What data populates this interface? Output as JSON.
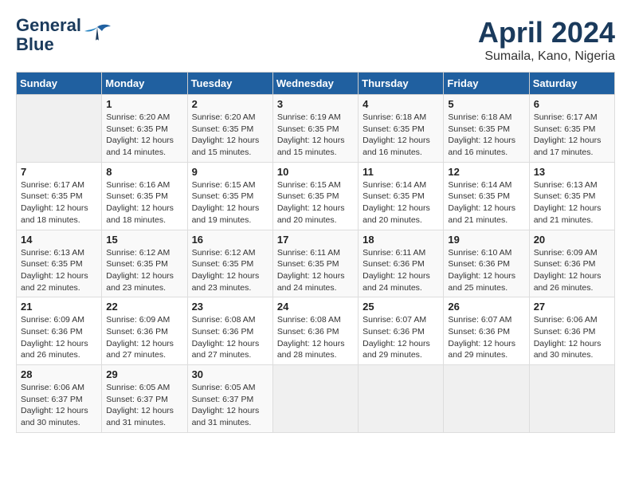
{
  "header": {
    "logo_line1": "General",
    "logo_line2": "Blue",
    "month": "April 2024",
    "location": "Sumaila, Kano, Nigeria"
  },
  "weekdays": [
    "Sunday",
    "Monday",
    "Tuesday",
    "Wednesday",
    "Thursday",
    "Friday",
    "Saturday"
  ],
  "weeks": [
    [
      {
        "day": "",
        "info": ""
      },
      {
        "day": "1",
        "info": "Sunrise: 6:20 AM\nSunset: 6:35 PM\nDaylight: 12 hours\nand 14 minutes."
      },
      {
        "day": "2",
        "info": "Sunrise: 6:20 AM\nSunset: 6:35 PM\nDaylight: 12 hours\nand 15 minutes."
      },
      {
        "day": "3",
        "info": "Sunrise: 6:19 AM\nSunset: 6:35 PM\nDaylight: 12 hours\nand 15 minutes."
      },
      {
        "day": "4",
        "info": "Sunrise: 6:18 AM\nSunset: 6:35 PM\nDaylight: 12 hours\nand 16 minutes."
      },
      {
        "day": "5",
        "info": "Sunrise: 6:18 AM\nSunset: 6:35 PM\nDaylight: 12 hours\nand 16 minutes."
      },
      {
        "day": "6",
        "info": "Sunrise: 6:17 AM\nSunset: 6:35 PM\nDaylight: 12 hours\nand 17 minutes."
      }
    ],
    [
      {
        "day": "7",
        "info": "Sunrise: 6:17 AM\nSunset: 6:35 PM\nDaylight: 12 hours\nand 18 minutes."
      },
      {
        "day": "8",
        "info": "Sunrise: 6:16 AM\nSunset: 6:35 PM\nDaylight: 12 hours\nand 18 minutes."
      },
      {
        "day": "9",
        "info": "Sunrise: 6:15 AM\nSunset: 6:35 PM\nDaylight: 12 hours\nand 19 minutes."
      },
      {
        "day": "10",
        "info": "Sunrise: 6:15 AM\nSunset: 6:35 PM\nDaylight: 12 hours\nand 20 minutes."
      },
      {
        "day": "11",
        "info": "Sunrise: 6:14 AM\nSunset: 6:35 PM\nDaylight: 12 hours\nand 20 minutes."
      },
      {
        "day": "12",
        "info": "Sunrise: 6:14 AM\nSunset: 6:35 PM\nDaylight: 12 hours\nand 21 minutes."
      },
      {
        "day": "13",
        "info": "Sunrise: 6:13 AM\nSunset: 6:35 PM\nDaylight: 12 hours\nand 21 minutes."
      }
    ],
    [
      {
        "day": "14",
        "info": "Sunrise: 6:13 AM\nSunset: 6:35 PM\nDaylight: 12 hours\nand 22 minutes."
      },
      {
        "day": "15",
        "info": "Sunrise: 6:12 AM\nSunset: 6:35 PM\nDaylight: 12 hours\nand 23 minutes."
      },
      {
        "day": "16",
        "info": "Sunrise: 6:12 AM\nSunset: 6:35 PM\nDaylight: 12 hours\nand 23 minutes."
      },
      {
        "day": "17",
        "info": "Sunrise: 6:11 AM\nSunset: 6:35 PM\nDaylight: 12 hours\nand 24 minutes."
      },
      {
        "day": "18",
        "info": "Sunrise: 6:11 AM\nSunset: 6:36 PM\nDaylight: 12 hours\nand 24 minutes."
      },
      {
        "day": "19",
        "info": "Sunrise: 6:10 AM\nSunset: 6:36 PM\nDaylight: 12 hours\nand 25 minutes."
      },
      {
        "day": "20",
        "info": "Sunrise: 6:09 AM\nSunset: 6:36 PM\nDaylight: 12 hours\nand 26 minutes."
      }
    ],
    [
      {
        "day": "21",
        "info": "Sunrise: 6:09 AM\nSunset: 6:36 PM\nDaylight: 12 hours\nand 26 minutes."
      },
      {
        "day": "22",
        "info": "Sunrise: 6:09 AM\nSunset: 6:36 PM\nDaylight: 12 hours\nand 27 minutes."
      },
      {
        "day": "23",
        "info": "Sunrise: 6:08 AM\nSunset: 6:36 PM\nDaylight: 12 hours\nand 27 minutes."
      },
      {
        "day": "24",
        "info": "Sunrise: 6:08 AM\nSunset: 6:36 PM\nDaylight: 12 hours\nand 28 minutes."
      },
      {
        "day": "25",
        "info": "Sunrise: 6:07 AM\nSunset: 6:36 PM\nDaylight: 12 hours\nand 29 minutes."
      },
      {
        "day": "26",
        "info": "Sunrise: 6:07 AM\nSunset: 6:36 PM\nDaylight: 12 hours\nand 29 minutes."
      },
      {
        "day": "27",
        "info": "Sunrise: 6:06 AM\nSunset: 6:36 PM\nDaylight: 12 hours\nand 30 minutes."
      }
    ],
    [
      {
        "day": "28",
        "info": "Sunrise: 6:06 AM\nSunset: 6:37 PM\nDaylight: 12 hours\nand 30 minutes."
      },
      {
        "day": "29",
        "info": "Sunrise: 6:05 AM\nSunset: 6:37 PM\nDaylight: 12 hours\nand 31 minutes."
      },
      {
        "day": "30",
        "info": "Sunrise: 6:05 AM\nSunset: 6:37 PM\nDaylight: 12 hours\nand 31 minutes."
      },
      {
        "day": "",
        "info": ""
      },
      {
        "day": "",
        "info": ""
      },
      {
        "day": "",
        "info": ""
      },
      {
        "day": "",
        "info": ""
      }
    ]
  ]
}
